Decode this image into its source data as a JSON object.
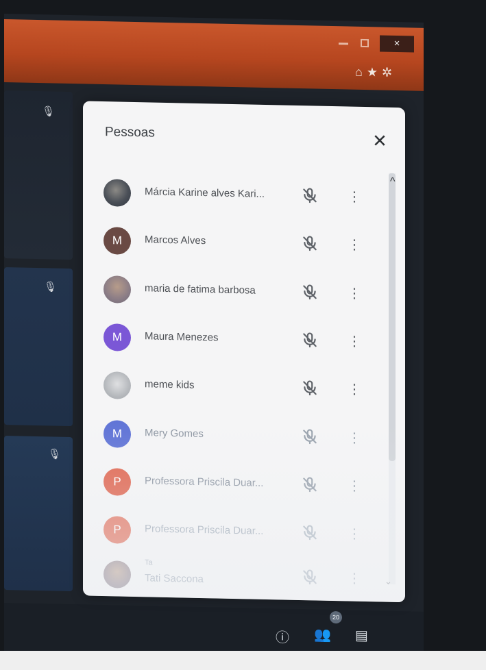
{
  "window": {
    "close_label": "×"
  },
  "panel": {
    "title": "Pessoas",
    "close_label": "✕",
    "participants": [
      {
        "name": "Márcia Karine alves Kari...",
        "initial": "",
        "avatar_color": "#4a4f57"
      },
      {
        "name": "Marcos Alves",
        "initial": "M",
        "avatar_color": "#6a4a44"
      },
      {
        "name": "maria de fatima barbosa",
        "initial": "",
        "avatar_color": "#8a7c86"
      },
      {
        "name": "Maura Menezes",
        "initial": "M",
        "avatar_color": "#7b57d6"
      },
      {
        "name": "meme kids",
        "initial": "",
        "avatar_color": "#b6b9bd"
      },
      {
        "name": "Mery Gomes",
        "initial": "M",
        "avatar_color": "#5f73d6"
      },
      {
        "name": "Professora Priscila Duar...",
        "initial": "P",
        "avatar_color": "#e0654f"
      },
      {
        "name": "Professora Priscila Duar...",
        "initial": "P",
        "avatar_color": "#e0654f"
      },
      {
        "name": "Tati Saccona",
        "sub": "Ta",
        "initial": "",
        "avatar_color": "#8a7c86"
      }
    ]
  },
  "bottom_bar": {
    "participant_count": "20"
  },
  "icons": {
    "mic_off": "mic-off-icon",
    "more": "more-vert-icon",
    "info": "info-icon",
    "people": "people-icon",
    "chat": "chat-icon"
  }
}
